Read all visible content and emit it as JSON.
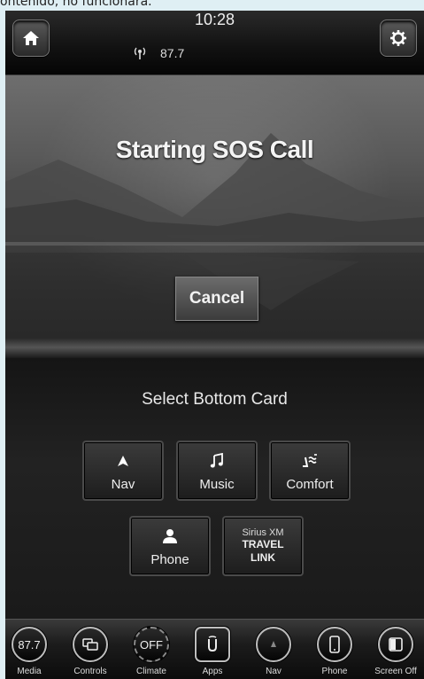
{
  "caption": "ontenido, no funcionará.",
  "status": {
    "time": "10:28",
    "radio_station": "87.7"
  },
  "scene": {
    "title": "Starting SOS Call",
    "cancel_label": "Cancel"
  },
  "cards": {
    "title": "Select Bottom Card",
    "items": [
      {
        "label": "Nav",
        "icon": "nav-arrow-icon"
      },
      {
        "label": "Music",
        "icon": "music-note-icon"
      },
      {
        "label": "Comfort",
        "icon": "comfort-seat-icon"
      },
      {
        "label": "Phone",
        "icon": "person-icon"
      }
    ],
    "siriusxm": {
      "line1": "Sirius XM",
      "line2": "TRAVEL",
      "line3": "LINK"
    }
  },
  "dock": {
    "media_value": "87.7",
    "climate_value": "OFF",
    "items": [
      "Media",
      "Controls",
      "Climate",
      "Apps",
      "Nav",
      "Phone",
      "Screen Off"
    ]
  }
}
